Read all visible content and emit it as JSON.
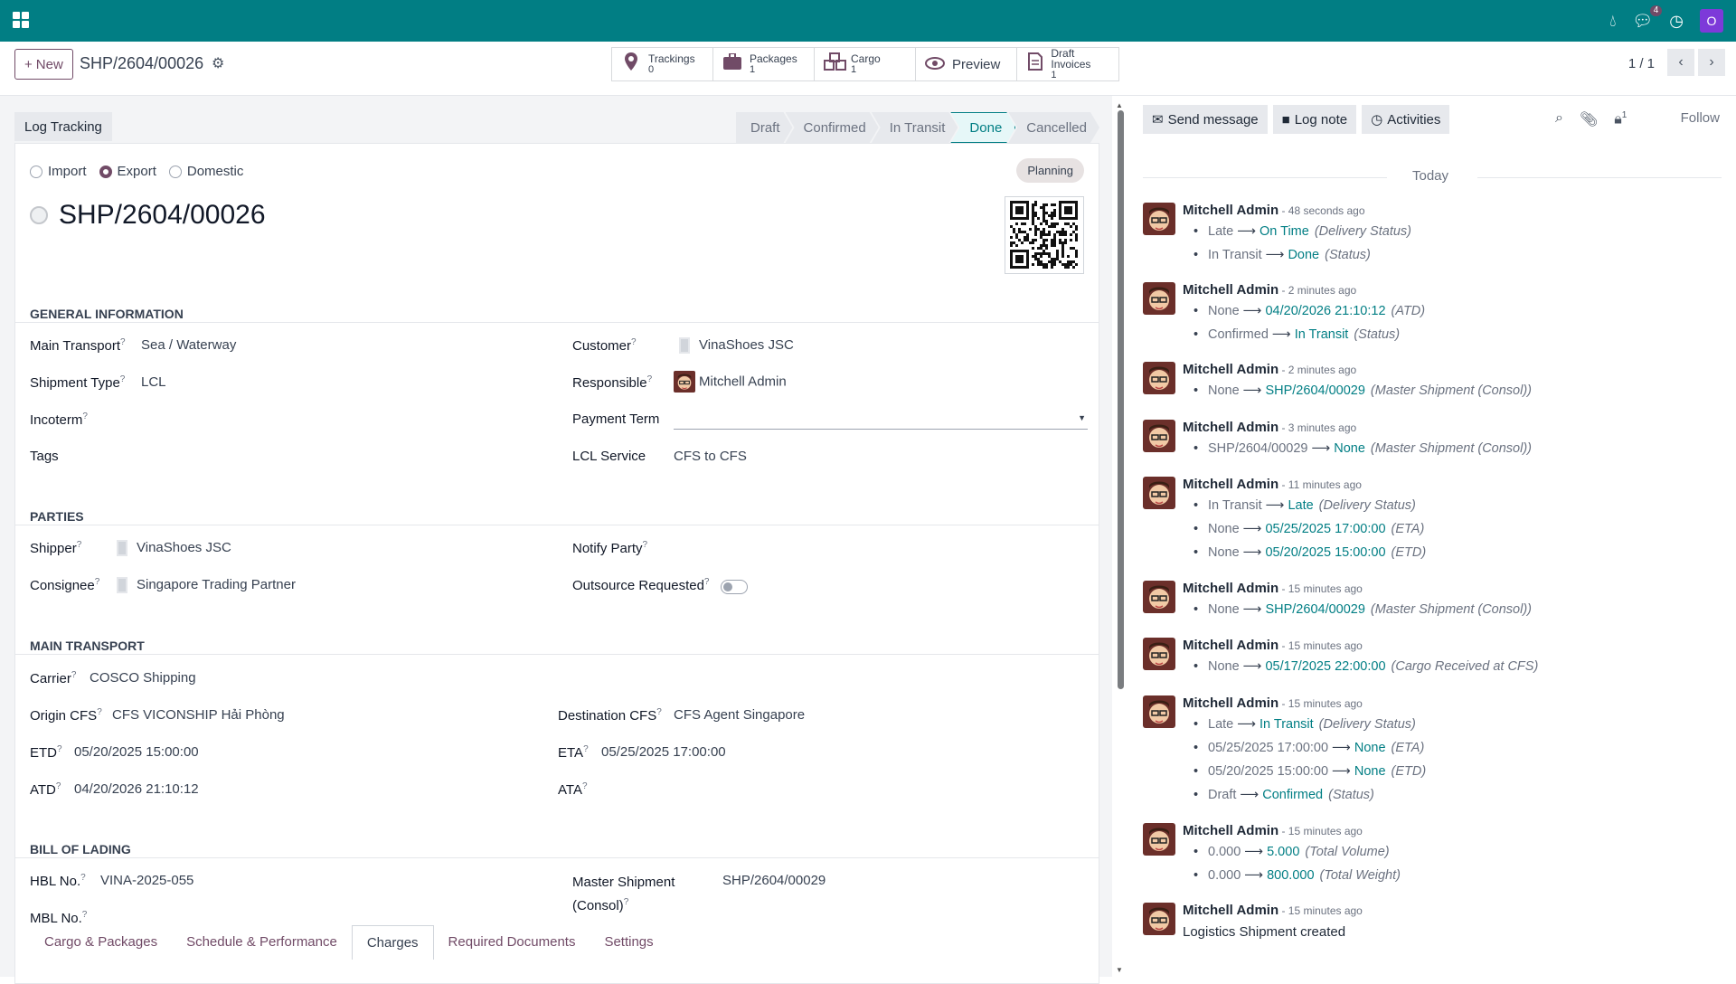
{
  "topbar": {
    "message_count": "4",
    "user_initial": "O"
  },
  "control": {
    "new_label": "New",
    "record_ref": "SHP/2604/00026",
    "pager": "1 / 1",
    "smart_buttons": [
      {
        "label": "Trackings",
        "value": "0",
        "icon": "map-pin-icon"
      },
      {
        "label": "Packages",
        "value": "1",
        "icon": "suitcase-icon"
      },
      {
        "label": "Cargo",
        "value": "1",
        "icon": "cubes-icon"
      },
      {
        "label": "Preview",
        "value": "",
        "icon": "eye-icon"
      },
      {
        "label": "Draft Invoices",
        "value": "1",
        "icon": "invoice-icon"
      }
    ]
  },
  "statusbar": {
    "log_tracking": "Log Tracking",
    "stages": [
      "Draft",
      "Confirmed",
      "In Transit",
      "Done",
      "Cancelled"
    ],
    "active_stage": "Done"
  },
  "form": {
    "shipment_modes": [
      "Import",
      "Export",
      "Domestic"
    ],
    "selected_mode": "Export",
    "state_badge": "Planning",
    "title": "SHP/2604/00026",
    "general": {
      "heading": "GENERAL INFORMATION",
      "main_transport_label": "Main Transport",
      "main_transport": "Sea / Waterway",
      "shipment_type_label": "Shipment Type",
      "shipment_type": "LCL",
      "incoterm_label": "Incoterm",
      "tags_label": "Tags",
      "customer_label": "Customer",
      "customer": "VinaShoes JSC",
      "responsible_label": "Responsible",
      "responsible": "Mitchell Admin",
      "payment_term_label": "Payment Term",
      "lcl_service_label": "LCL Service",
      "lcl_service": "CFS to CFS"
    },
    "parties": {
      "heading": "PARTIES",
      "shipper_label": "Shipper",
      "shipper": "VinaShoes JSC",
      "consignee_label": "Consignee",
      "consignee": "Singapore Trading Partner",
      "notify_label": "Notify Party",
      "outsource_label": "Outsource Requested"
    },
    "transport": {
      "heading": "MAIN TRANSPORT",
      "carrier_label": "Carrier",
      "carrier": "COSCO Shipping",
      "origin_label": "Origin CFS",
      "origin": "CFS VICONSHIP Hải Phòng",
      "dest_label": "Destination CFS",
      "dest": "CFS Agent Singapore",
      "etd_label": "ETD",
      "etd": "05/20/2025 15:00:00",
      "eta_label": "ETA",
      "eta": "05/25/2025 17:00:00",
      "atd_label": "ATD",
      "atd": "04/20/2026 21:10:12",
      "ata_label": "ATA"
    },
    "bol": {
      "heading": "BILL OF LADING",
      "hbl_label": "HBL No.",
      "hbl": "VINA-2025-055",
      "mbl_label": "MBL No.",
      "master_label_1": "Master Shipment",
      "master_label_2": "(Consol)",
      "master": "SHP/2604/00029"
    },
    "tabs": [
      "Cargo & Packages",
      "Schedule & Performance",
      "Charges",
      "Required Documents",
      "Settings"
    ],
    "active_tab": "Charges"
  },
  "chatter": {
    "send_message": "Send message",
    "log_note": "Log note",
    "activities": "Activities",
    "follower_count": "1",
    "follow": "Follow",
    "today": "Today",
    "messages": [
      {
        "author": "Mitchell Admin",
        "time": "- 48 seconds ago",
        "changes": [
          {
            "old": "Late",
            "new": "On Time",
            "field": "(Delivery Status)"
          },
          {
            "old": "In Transit",
            "new": "Done",
            "field": "(Status)"
          }
        ]
      },
      {
        "author": "Mitchell Admin",
        "time": "- 2 minutes ago",
        "changes": [
          {
            "old": "None",
            "new": "04/20/2026 21:10:12",
            "field": "(ATD)"
          },
          {
            "old": "Confirmed",
            "new": "In Transit",
            "field": "(Status)"
          }
        ]
      },
      {
        "author": "Mitchell Admin",
        "time": "- 2 minutes ago",
        "changes": [
          {
            "old": "None",
            "new": "SHP/2604/00029",
            "field": "(Master Shipment (Consol))"
          }
        ]
      },
      {
        "author": "Mitchell Admin",
        "time": "- 3 minutes ago",
        "changes": [
          {
            "old": "SHP/2604/00029",
            "new": "None",
            "field": "(Master Shipment (Consol))"
          }
        ]
      },
      {
        "author": "Mitchell Admin",
        "time": "- 11 minutes ago",
        "changes": [
          {
            "old": "In Transit",
            "new": "Late",
            "field": "(Delivery Status)"
          },
          {
            "old": "None",
            "new": "05/25/2025 17:00:00",
            "field": "(ETA)"
          },
          {
            "old": "None",
            "new": "05/20/2025 15:00:00",
            "field": "(ETD)"
          }
        ]
      },
      {
        "author": "Mitchell Admin",
        "time": "- 15 minutes ago",
        "changes": [
          {
            "old": "None",
            "new": "SHP/2604/00029",
            "field": "(Master Shipment (Consol))"
          }
        ]
      },
      {
        "author": "Mitchell Admin",
        "time": "- 15 minutes ago",
        "changes": [
          {
            "old": "None",
            "new": "05/17/2025 22:00:00",
            "field": "(Cargo Received at CFS)"
          }
        ]
      },
      {
        "author": "Mitchell Admin",
        "time": "- 15 minutes ago",
        "changes": [
          {
            "old": "Late",
            "new": "In Transit",
            "field": "(Delivery Status)"
          },
          {
            "old": "05/25/2025 17:00:00",
            "new": "None",
            "field": "(ETA)"
          },
          {
            "old": "05/20/2025 15:00:00",
            "new": "None",
            "field": "(ETD)"
          },
          {
            "old": "Draft",
            "new": "Confirmed",
            "field": "(Status)"
          }
        ]
      },
      {
        "author": "Mitchell Admin",
        "time": "- 15 minutes ago",
        "changes": [
          {
            "old": "0.000",
            "new": "5.000",
            "field": "(Total Volume)"
          },
          {
            "old": "0.000",
            "new": "800.000",
            "field": "(Total Weight)"
          }
        ]
      },
      {
        "author": "Mitchell Admin",
        "time": "- 15 minutes ago",
        "body": "Logistics Shipment created",
        "changes": []
      }
    ]
  }
}
